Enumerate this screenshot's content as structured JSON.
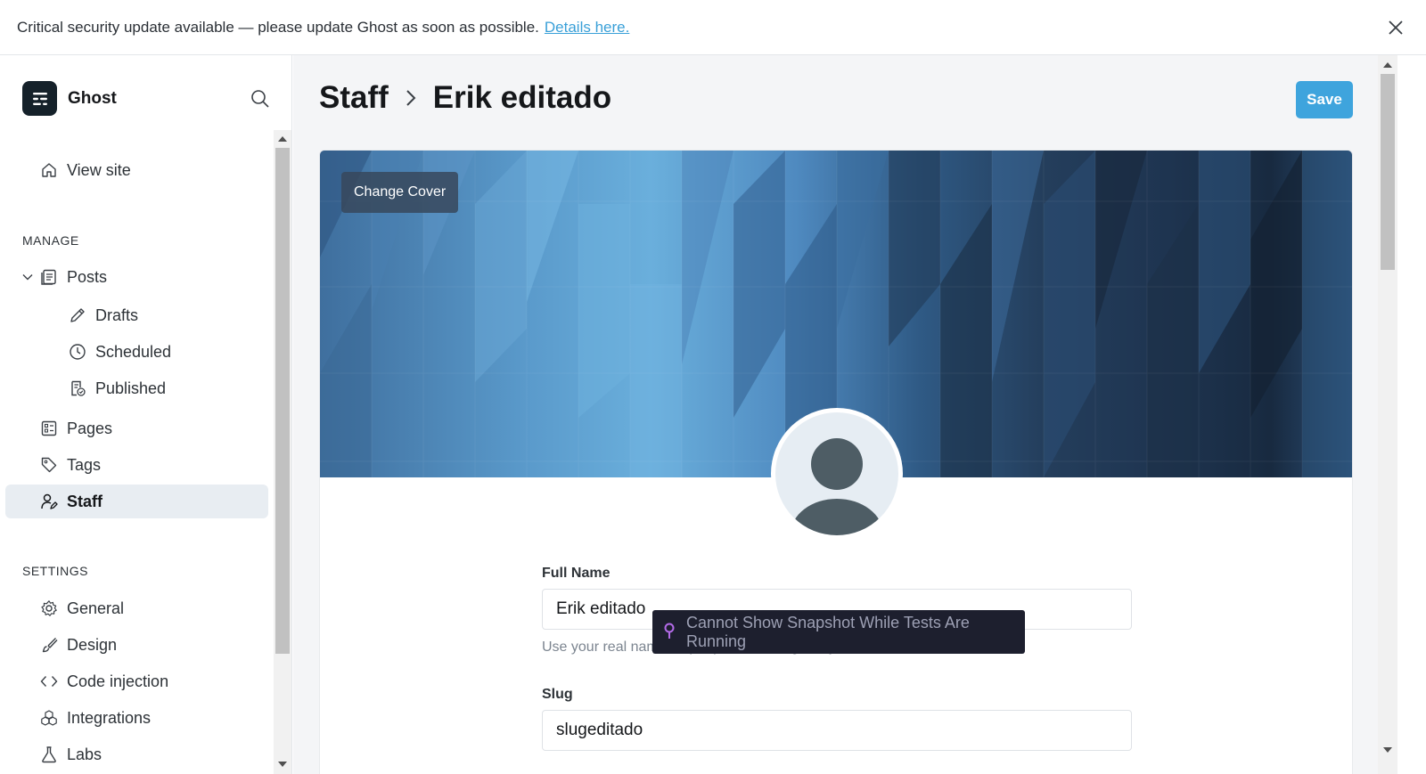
{
  "banner": {
    "message": "Critical security update available — please update Ghost as soon as possible.",
    "link_text": "Details here."
  },
  "sidebar": {
    "brand": "Ghost",
    "view_site": "View site",
    "manage_title": "MANAGE",
    "posts": "Posts",
    "drafts": "Drafts",
    "scheduled": "Scheduled",
    "published": "Published",
    "pages": "Pages",
    "tags": "Tags",
    "staff": "Staff",
    "settings_title": "SETTINGS",
    "general": "General",
    "design": "Design",
    "code_injection": "Code injection",
    "integrations": "Integrations",
    "labs": "Labs"
  },
  "header": {
    "crumb_parent": "Staff",
    "crumb_current": "Erik editado",
    "save_label": "Save"
  },
  "profile": {
    "change_cover": "Change Cover",
    "full_name_label": "Full Name",
    "full_name_value": "Erik editado",
    "full_name_hint": "Use your real name so people can recognise you",
    "slug_label": "Slug",
    "slug_value": "slugeditado"
  },
  "tooltip": {
    "text": "Cannot Show Snapshot While Tests Are Running"
  },
  "colors": {
    "accent": "#3ea4dd",
    "active_nav_bg": "#e8edf2",
    "tooltip_bg": "#1d1f2e",
    "tooltip_icon": "#b36be8"
  }
}
